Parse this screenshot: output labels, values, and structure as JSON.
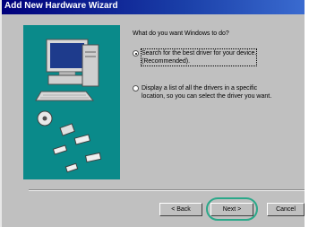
{
  "window": {
    "title": "Add New Hardware Wizard"
  },
  "content": {
    "prompt": "What do you want Windows to do?",
    "options": [
      {
        "line1": "Search for the best driver for your device.",
        "line2": "(Recommended).",
        "selected": true
      },
      {
        "line1": "Display a list of all the drivers in a specific",
        "line2": "location, so you can select the driver you want.",
        "selected": false
      }
    ]
  },
  "buttons": {
    "back": "< Back",
    "next": "Next >",
    "cancel": "Cancel"
  },
  "illustration": {
    "icons": [
      "computer-icon",
      "disk-icon",
      "chip-icon"
    ]
  },
  "colors": {
    "titlebar": "#00007b",
    "highlight_ring": "#2aa889"
  }
}
